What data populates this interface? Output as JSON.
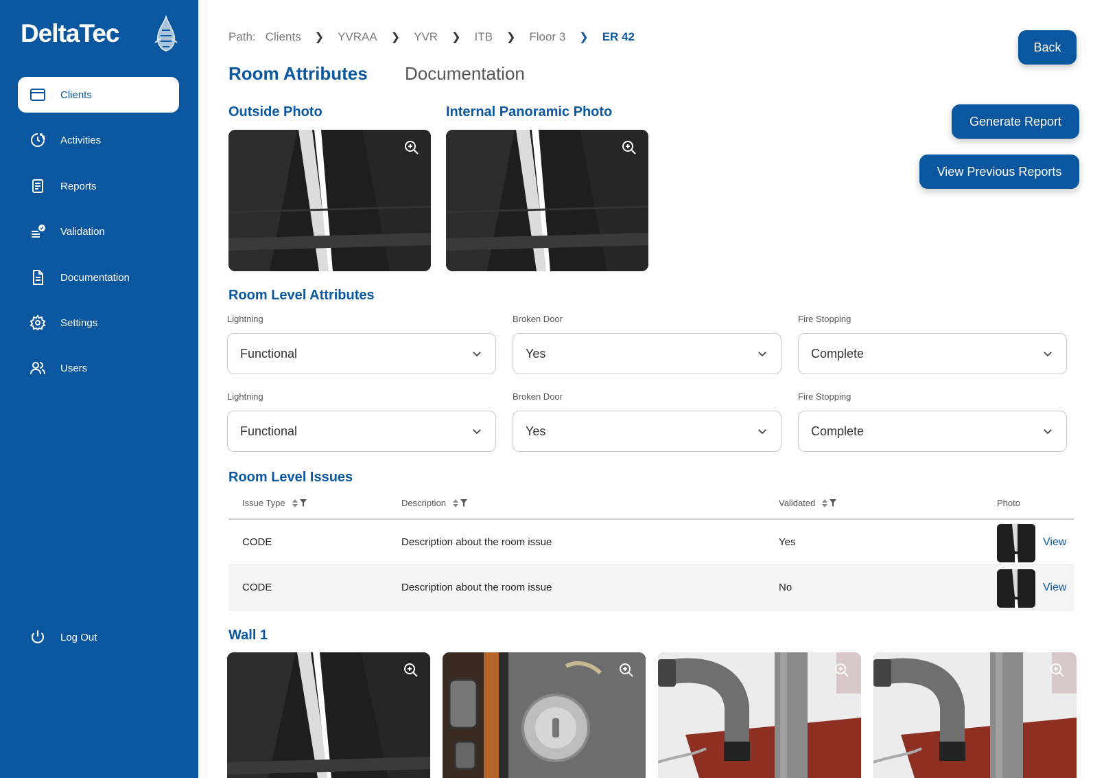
{
  "brand": {
    "name": "DeltaTec"
  },
  "sidebar": {
    "items": [
      {
        "label": "Clients",
        "icon": "window-icon"
      },
      {
        "label": "Activities",
        "icon": "activity-clock-icon"
      },
      {
        "label": "Reports",
        "icon": "report-icon"
      },
      {
        "label": "Validation",
        "icon": "validation-list-icon"
      },
      {
        "label": "Documentation",
        "icon": "document-icon"
      },
      {
        "label": "Settings",
        "icon": "gear-icon"
      },
      {
        "label": "Users",
        "icon": "users-icon"
      }
    ],
    "logout": "Log Out"
  },
  "breadcrumb": {
    "label": "Path:",
    "items": [
      "Clients",
      "YVRAA",
      "YVR",
      "ITB",
      "Floor 3",
      "ER 42"
    ]
  },
  "tabs": {
    "active": "Room Attributes",
    "inactive": "Documentation"
  },
  "buttons": {
    "back": "Back",
    "generate": "Generate Report",
    "previous": "View Previous Reports"
  },
  "photos": {
    "outside_title": "Outside Photo",
    "internal_title": "Internal Panoramic Photo"
  },
  "attributes": {
    "title": "Room Level Attributes",
    "rows": [
      [
        {
          "label": "Lightning",
          "value": "Functional"
        },
        {
          "label": "Broken Door",
          "value": "Yes"
        },
        {
          "label": "Fire Stopping",
          "value": "Complete"
        }
      ],
      [
        {
          "label": "Lightning",
          "value": "Functional"
        },
        {
          "label": "Broken Door",
          "value": "Yes"
        },
        {
          "label": "Fire Stopping",
          "value": "Complete"
        }
      ]
    ]
  },
  "issues": {
    "title": "Room Level Issues",
    "columns": [
      "Issue Type",
      "Description",
      "Validated",
      "Photo"
    ],
    "rows": [
      {
        "type": "CODE",
        "description": "Description about the room issue",
        "validated": "Yes",
        "link": "View"
      },
      {
        "type": "CODE",
        "description": "Description about the room issue",
        "validated": "No",
        "link": "View"
      }
    ]
  },
  "wall": {
    "title": "Wall 1"
  },
  "colors": {
    "primary": "#0a57a0",
    "white": "#ffffff"
  }
}
